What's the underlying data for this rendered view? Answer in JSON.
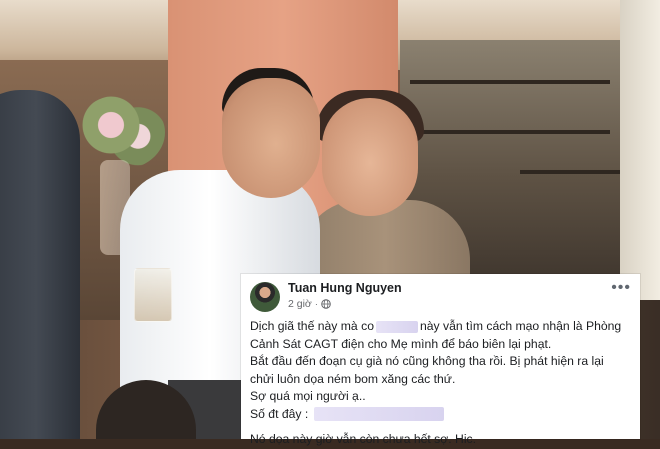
{
  "post": {
    "author": "Tuan Hung Nguyen",
    "time": "2 giờ",
    "separator": "·",
    "privacy_icon": "globe-icon",
    "more_icon": "more-options-icon",
    "more_symbol": "•••",
    "lines": [
      {
        "before": "Dịch giã thế này mà co",
        "after": "này vẫn tìm cách mạo nhận là Phòng"
      },
      {
        "text": "Cảnh Sát CAGT điện cho Mẹ mình để báo biên lại phạt."
      },
      {
        "text": "Bắt đầu đến đoạn cụ già nó cũng không tha rồi.  Bị phát hiện ra lại"
      },
      {
        "text": "chửi luôn dọa ném bom xăng các thứ."
      },
      {
        "text": "Sợ quá mọi người ạ.."
      },
      {
        "label": "Số đt đây :"
      },
      {
        "text": "Nó dọa này giờ vẫn còn chưa hết sợ. Hic."
      }
    ],
    "redacted": "blurred-text"
  },
  "colors": {
    "card_bg": "#ffffff",
    "text": "#1c1e21",
    "meta_text": "#65676b",
    "redaction": "#ddd8f2"
  }
}
